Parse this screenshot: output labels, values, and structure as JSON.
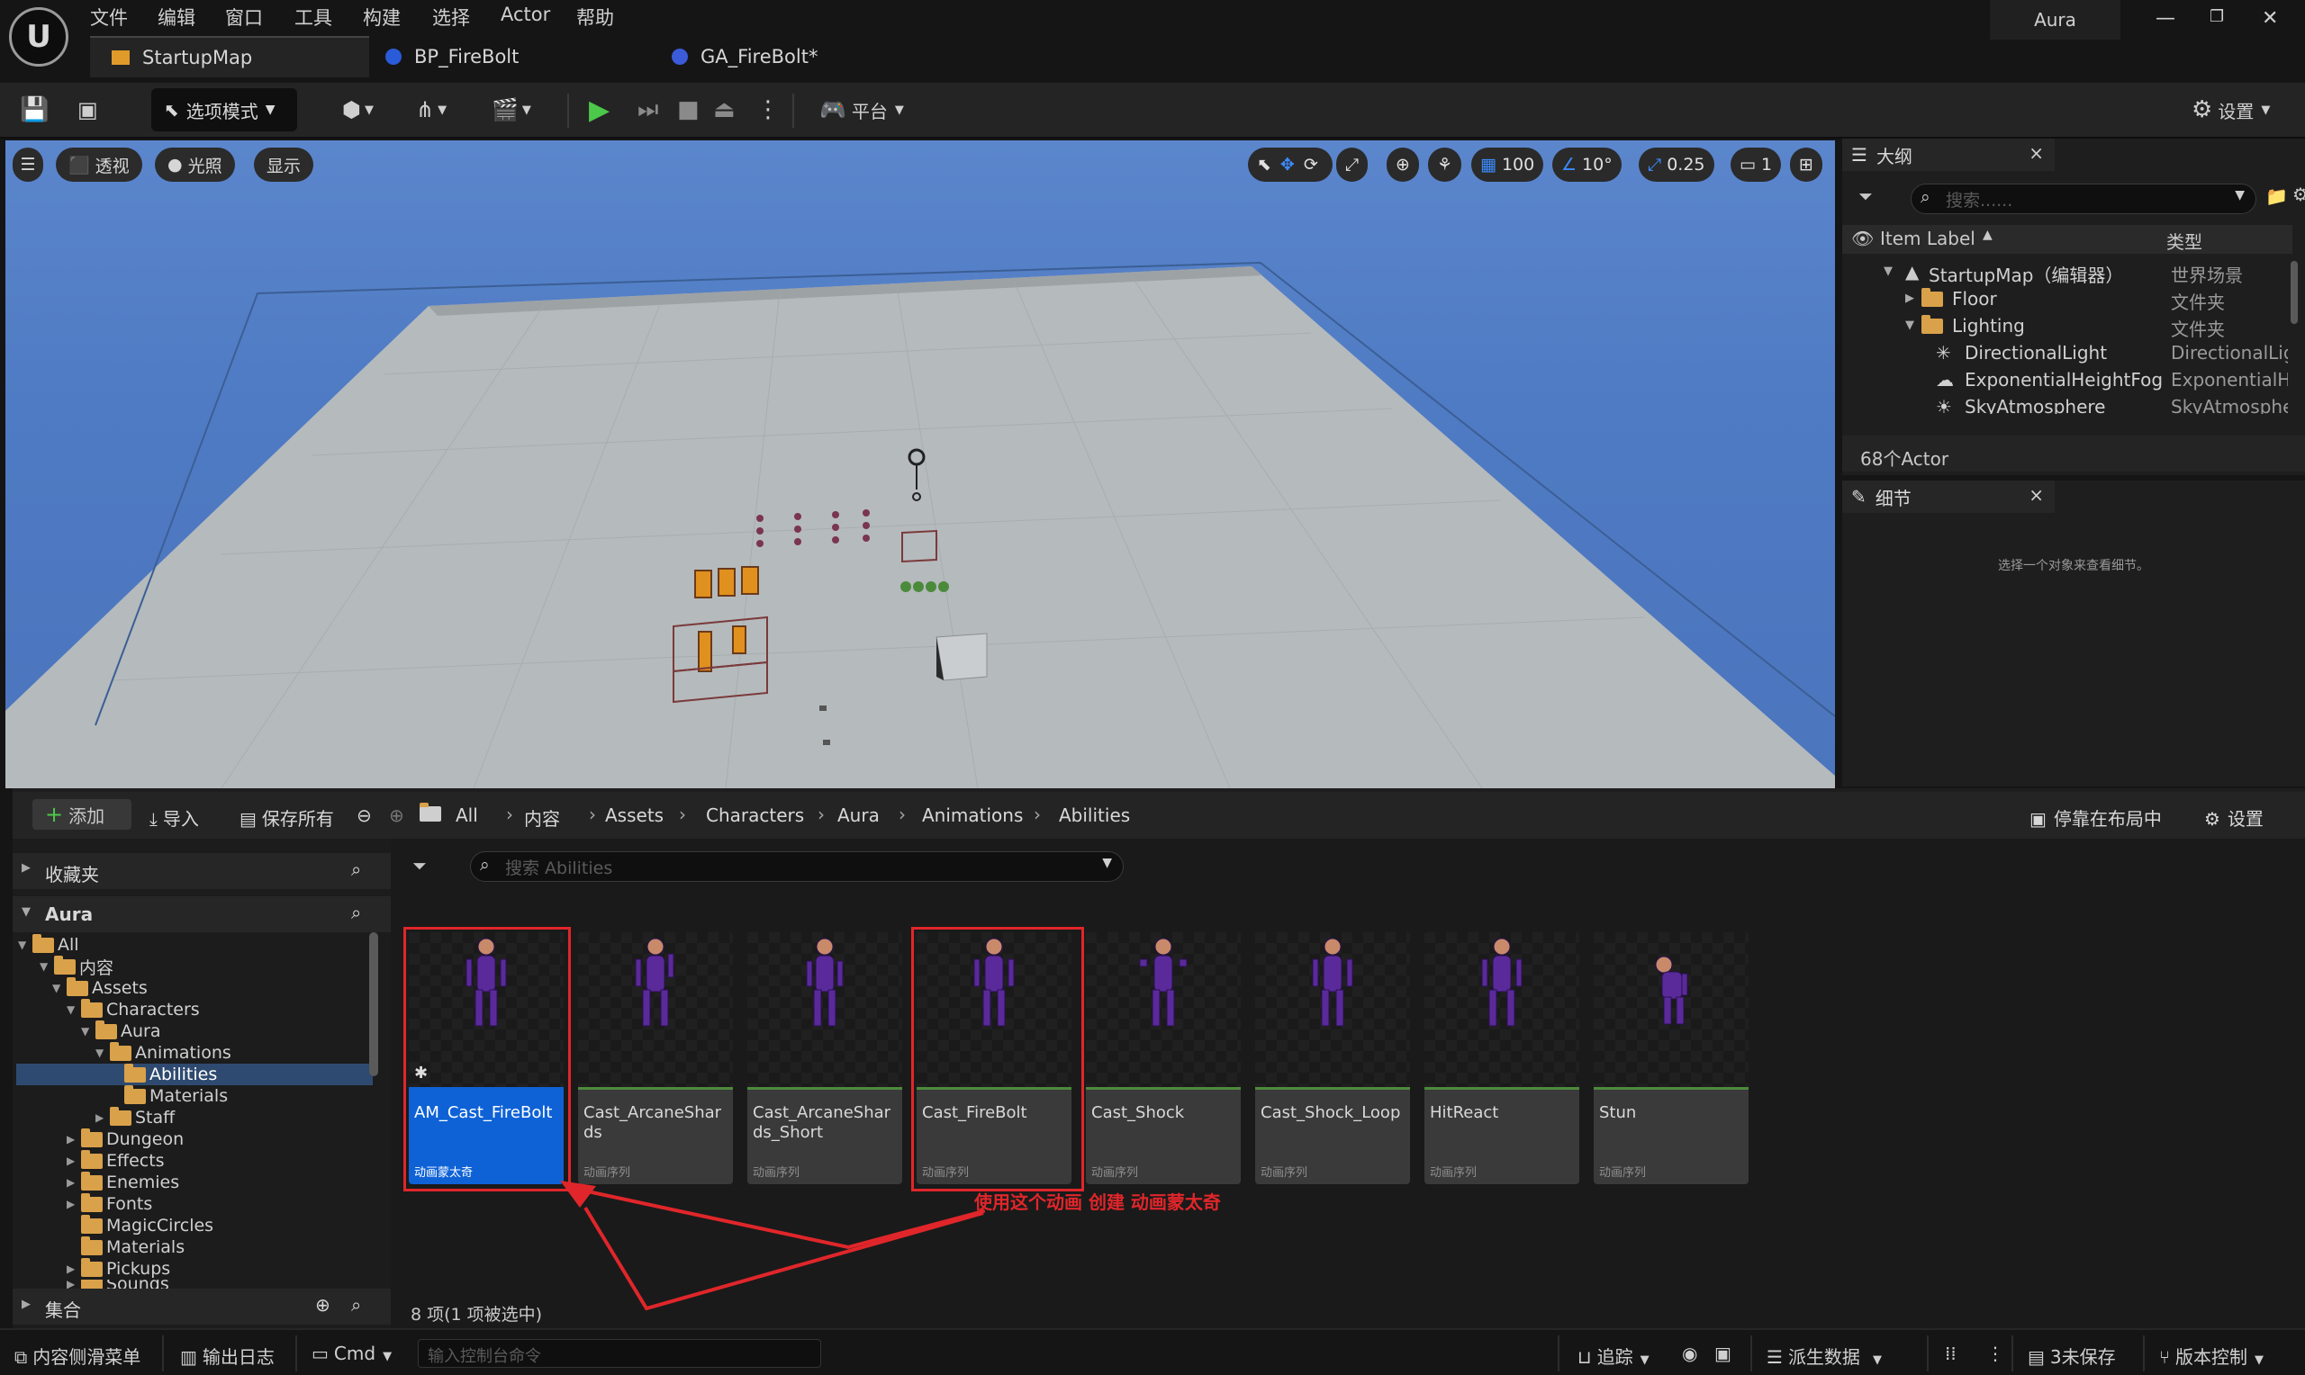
{
  "app": {
    "project_name": "Aura",
    "menu": [
      "文件",
      "编辑",
      "窗口",
      "工具",
      "构建",
      "选择",
      "Actor",
      "帮助"
    ],
    "tabs": [
      {
        "label": "StartupMap",
        "active": true
      },
      {
        "label": "BP_FireBolt",
        "active": false
      },
      {
        "label": "GA_FireBolt*",
        "active": false
      }
    ]
  },
  "toolbar": {
    "mode_label": "选项模式",
    "platform_label": "平台",
    "settings_label": "设置"
  },
  "viewport": {
    "perspective_label": "透视",
    "lighting_label": "光照",
    "show_label": "显示",
    "grid_snap": "100",
    "rotate_snap": "10°",
    "scale_snap": "0.25",
    "camera_speed": "1"
  },
  "outliner": {
    "title": "大纲",
    "search_placeholder": "搜索......",
    "col_label": "Item Label",
    "col_type": "类型",
    "rows": [
      {
        "label": "StartupMap（编辑器）",
        "type": "世界场景"
      },
      {
        "label": "Floor",
        "type": "文件夹"
      },
      {
        "label": "Lighting",
        "type": "文件夹"
      },
      {
        "label": "DirectionalLight",
        "type": "DirectionalLight"
      },
      {
        "label": "ExponentialHeightFog",
        "type": "ExponentialHeightFog"
      },
      {
        "label": "SkyAtmosphere",
        "type": "SkyAtmosphere"
      }
    ],
    "actor_count": "68个Actor"
  },
  "details": {
    "title": "细节",
    "empty_hint": "选择一个对象来查看细节。"
  },
  "content_browser": {
    "add_label": "添加",
    "import_label": "导入",
    "save_all_label": "保存所有",
    "breadcrumb": [
      "All",
      "内容",
      "Assets",
      "Characters",
      "Aura",
      "Animations",
      "Abilities"
    ],
    "dock_label": "停靠在布局中",
    "settings_label": "设置",
    "favorites_label": "收藏夹",
    "tree_root_label": "Aura",
    "collections_label": "集合",
    "search_placeholder": "搜索 Abilities",
    "tree": [
      "All",
      "内容",
      "Assets",
      "Characters",
      "Aura",
      "Animations",
      "Abilities",
      "Materials",
      "Staff",
      "Dungeon",
      "Effects",
      "Enemies",
      "Fonts",
      "MagicCircles",
      "Materials",
      "Pickups",
      "Sounds"
    ],
    "assets": [
      {
        "name": "AM_Cast_FireBolt",
        "type": "动画蒙太奇",
        "selected": true
      },
      {
        "name": "Cast_ArcaneShards",
        "type": "动画序列",
        "selected": false
      },
      {
        "name": "Cast_ArcaneShards_Short",
        "type": "动画序列",
        "selected": false
      },
      {
        "name": "Cast_FireBolt",
        "type": "动画序列",
        "selected": false
      },
      {
        "name": "Cast_Shock",
        "type": "动画序列",
        "selected": false
      },
      {
        "name": "Cast_Shock_Loop",
        "type": "动画序列",
        "selected": false
      },
      {
        "name": "HitReact",
        "type": "动画序列",
        "selected": false
      },
      {
        "name": "Stun",
        "type": "动画序列",
        "selected": false
      }
    ],
    "item_count": "8 项(1 项被选中)",
    "annotation": "使用这个动画 创建 动画蒙太奇"
  },
  "statusbar": {
    "drawer_label": "内容侧滑菜单",
    "output_log_label": "输出日志",
    "cmd_label": "Cmd",
    "console_placeholder": "输入控制台命令",
    "trace_label": "追踪",
    "derived_data_label": "派生数据",
    "unsaved_label": "3未保存",
    "source_control_label": "版本控制"
  },
  "colors": {
    "accent_selection": "#0e62d6",
    "annotation_red": "#e0262a",
    "play_green": "#4cc84a",
    "sky_blue": "#5b86cc"
  }
}
